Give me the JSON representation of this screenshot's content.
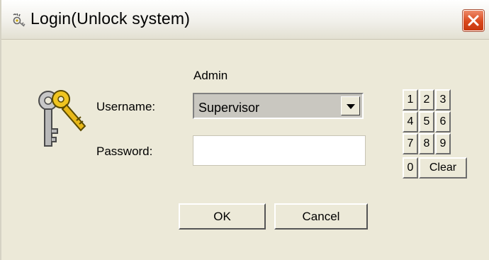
{
  "window": {
    "title": "Login(Unlock system)",
    "title_icon": "keys-icon",
    "close_icon": "close-icon"
  },
  "form": {
    "role_text": "Admin",
    "username_label": "Username:",
    "username_value": "Supervisor",
    "password_label": "Password:",
    "password_value": "",
    "key_icon": "key-icon"
  },
  "buttons": {
    "ok": "OK",
    "cancel": "Cancel"
  },
  "keypad": {
    "keys": [
      "1",
      "2",
      "3",
      "4",
      "5",
      "6",
      "7",
      "8",
      "9",
      "0",
      "Clear"
    ]
  },
  "colors": {
    "dialog_bg": "#ece9d8",
    "close_button": "#d9481c",
    "combo_bg": "#c9c7c0"
  }
}
